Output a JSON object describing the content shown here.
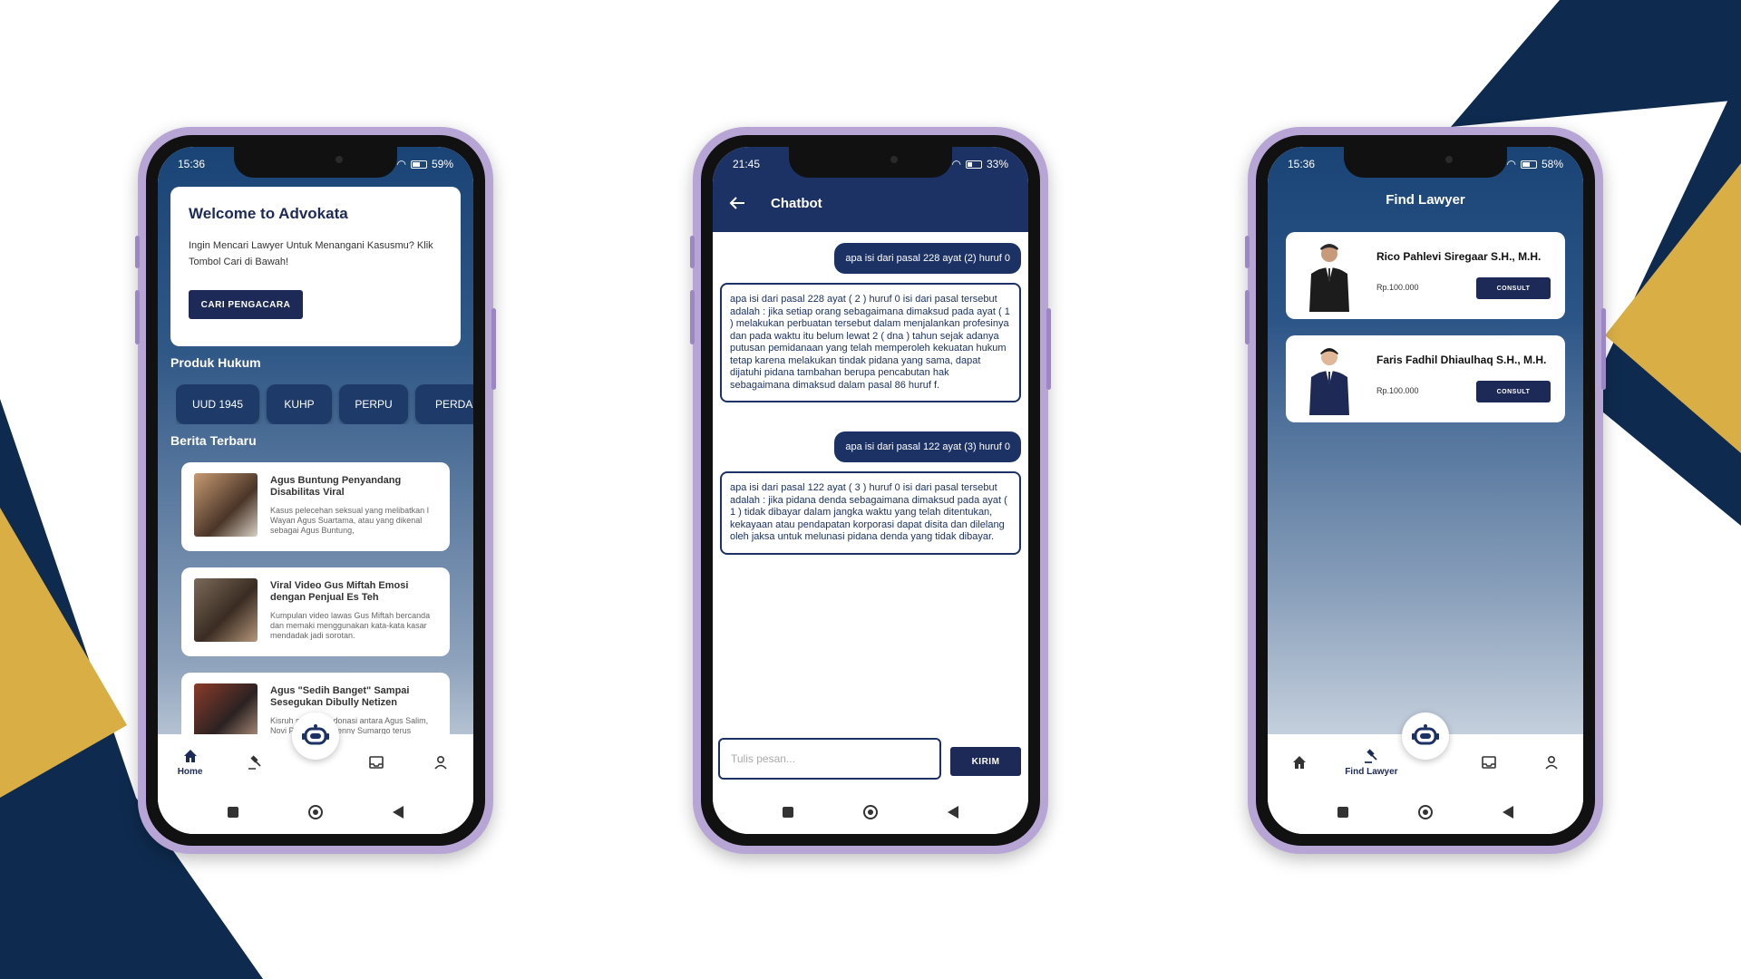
{
  "colors": {
    "navy": "#0e2a4e",
    "gold": "#d8ae45",
    "primary": "#1d2a57"
  },
  "status": {
    "home": {
      "time": "15:36",
      "battery": "59%"
    },
    "chat": {
      "time": "21:45",
      "battery": "33%"
    },
    "lawyer": {
      "time": "15:36",
      "battery": "58%"
    }
  },
  "home": {
    "welcome_title": "Welcome to Advokata",
    "welcome_text": "Ingin Mencari Lawyer Untuk Menangani Kasusmu? Klik Tombol Cari di Bawah!",
    "cta": "CARI PENGACARA",
    "produk_title": "Produk Hukum",
    "chips": [
      "UUD 1945",
      "KUHP",
      "PERPU",
      "PERDA"
    ],
    "berita_title": "Berita Terbaru",
    "news": [
      {
        "title": "Agus Buntung Penyandang Disabilitas Viral",
        "summary": "Kasus pelecehan seksual yang melibatkan I Wayan Agus Suartama, atau yang dikenal sebagai Agus Buntung,"
      },
      {
        "title": "Viral Video Gus Miftah Emosi dengan Penjual Es Teh",
        "summary": "Kumpulan video lawas Gus Miftah bercanda dan memaki menggunakan kata-kata kasar mendadak jadi sorotan."
      },
      {
        "title": "Agus \"Sedih Banget\" Sampai Sesegukan Dibully Netizen",
        "summary": "Kisruh soal uang donasi antara Agus Salim, Novi Pratiwi dan Denny Sumargo terus berlanjut makin"
      }
    ],
    "tab_home": "Home"
  },
  "chat": {
    "title": "Chatbot",
    "messages": [
      {
        "from": "user",
        "text": "apa isi dari pasal 228 ayat (2) huruf 0"
      },
      {
        "from": "bot",
        "text": "apa isi dari pasal 228 ayat ( 2 ) huruf 0 isi dari pasal tersebut adalah : jika setiap orang sebagaimana dimaksud pada ayat ( 1 ) melakukan perbuatan tersebut dalam menjalankan profesinya dan pada waktu itu belum lewat 2 ( dna ) tahun sejak adanya putusan pemidanaan yang telah memperoleh kekuatan hukum tetap karena melakukan tindak pidana yang sama, dapat dijatuhi pidana tambahan berupa pencabutan hak sebagaimana dimaksud dalam pasal 86 huruf f."
      },
      {
        "from": "user",
        "text": "apa isi dari pasal 122 ayat (3) huruf 0"
      },
      {
        "from": "bot",
        "text": "apa isi dari pasal 122 ayat ( 3 ) huruf 0 isi dari pasal tersebut adalah : jika pidana denda sebagaimana dimaksud pada ayat ( 1 ) tidak dibayar dalam jangka waktu yang telah ditentukan, kekayaan atau pendapatan korporasi dapat disita dan dilelang oleh jaksa untuk melunasi pidana denda yang tidak dibayar."
      }
    ],
    "input_placeholder": "Tulis pesan...",
    "send": "KIRIM"
  },
  "lawyer": {
    "title": "Find Lawyer",
    "cards": [
      {
        "name": "Rico Pahlevi Siregaar S.H., M.H.",
        "price": "Rp.100.000",
        "button": "CONSULT"
      },
      {
        "name": "Faris Fadhil Dhiaulhaq S.H., M.H.",
        "price": "Rp.100.000",
        "button": "CONSULT"
      }
    ],
    "tab_find": "Find Lawyer"
  }
}
